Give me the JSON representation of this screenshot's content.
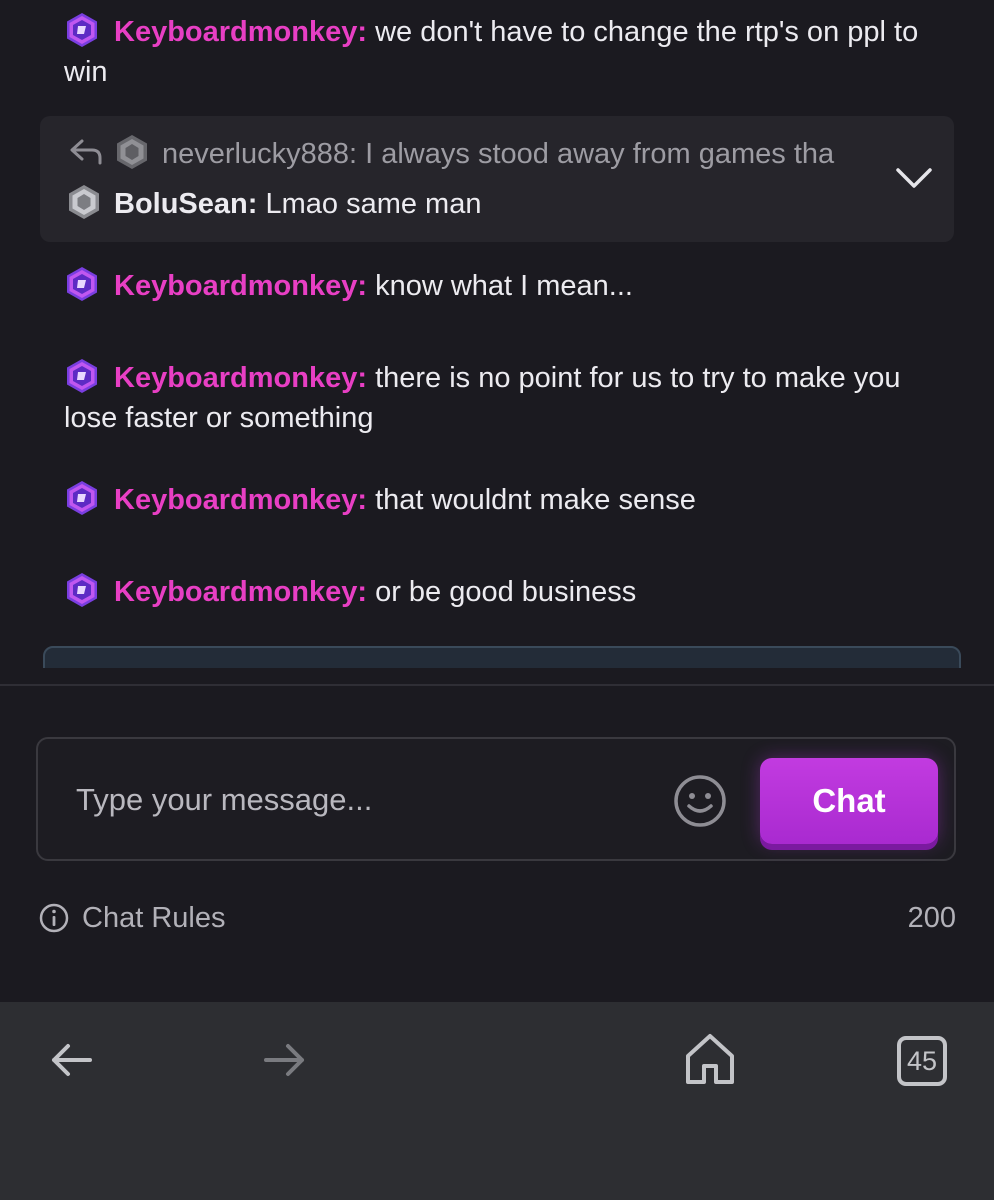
{
  "messages": [
    {
      "user": "Keyboardmonkey:",
      "text": "we don't have to change the rtp's on ppl to win"
    },
    {
      "user": "Keyboardmonkey:",
      "text": "know what I mean..."
    },
    {
      "user": "Keyboardmonkey:",
      "text": "there is no point for us to try to make you lose faster or something"
    },
    {
      "user": "Keyboardmonkey:",
      "text": "that wouldnt make sense"
    },
    {
      "user": "Keyboardmonkey:",
      "text": "or be good business"
    }
  ],
  "reply": {
    "quoted_user": "neverlucky888:",
    "quoted_text": "I always stood away from games tha",
    "user": "BoluSean:",
    "text": "Lmao same man"
  },
  "composer": {
    "placeholder": "Type your message...",
    "send_label": "Chat"
  },
  "footer": {
    "rules_label": "Chat Rules",
    "char_limit": "200"
  },
  "browser": {
    "tab_count": "45"
  },
  "colors": {
    "username_accent": "#e83fc4",
    "send_button": "#b632d9",
    "background": "#1b1a20"
  }
}
